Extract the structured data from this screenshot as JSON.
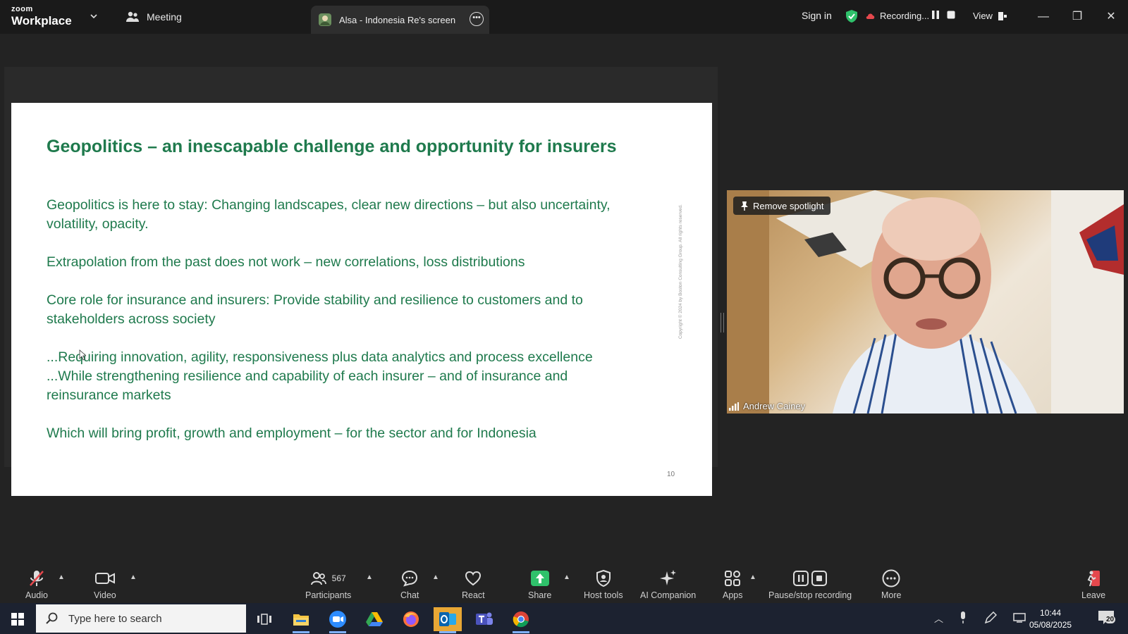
{
  "titlebar": {
    "brand_top": "zoom",
    "brand_bottom": "Workplace",
    "meeting_label": "Meeting",
    "share_tab_label": "Alsa - Indonesia Re's screen",
    "sign_in": "Sign in",
    "recording_label": "Recording...",
    "view_label": "View"
  },
  "slide": {
    "title": "Geopolitics – an inescapable challenge and opportunity for insurers",
    "paragraphs": [
      "Geopolitics is here to stay: Changing landscapes, clear new directions – but also uncertainty, volatility, opacity.",
      "Extrapolation from the past does not work – new correlations, loss distributions",
      "Core role for insurance and insurers: Provide stability and resilience to customers and to stakeholders across society",
      "...Requiring innovation, agility, responsiveness plus data analytics and process excellence ...While strengthening resilience and capability of each insurer – and of insurance and reinsurance markets",
      "Which will bring profit, growth and employment – for the sector and for Indonesia"
    ],
    "page_number": "10",
    "copyright": "Copyright © 2024 by Boston Consulting Group. All rights reserved."
  },
  "video": {
    "spotlight_button": "Remove spotlight",
    "participant_name": "Andrew Cainey"
  },
  "toolbar": {
    "audio": "Audio",
    "video": "Video",
    "participants": "Participants",
    "participants_count": "567",
    "chat": "Chat",
    "react": "React",
    "share": "Share",
    "host_tools": "Host tools",
    "ai_companion": "AI Companion",
    "apps": "Apps",
    "pause_stop": "Pause/stop recording",
    "more": "More",
    "leave": "Leave"
  },
  "taskbar": {
    "search_placeholder": "Type here to search",
    "time": "10:44",
    "date": "05/08/2025",
    "notifications": "20"
  },
  "colors": {
    "slide_green": "#1f7a4d",
    "share_green": "#2fc16b",
    "recording_red": "#e5484d",
    "leave_red": "#e5484d"
  }
}
